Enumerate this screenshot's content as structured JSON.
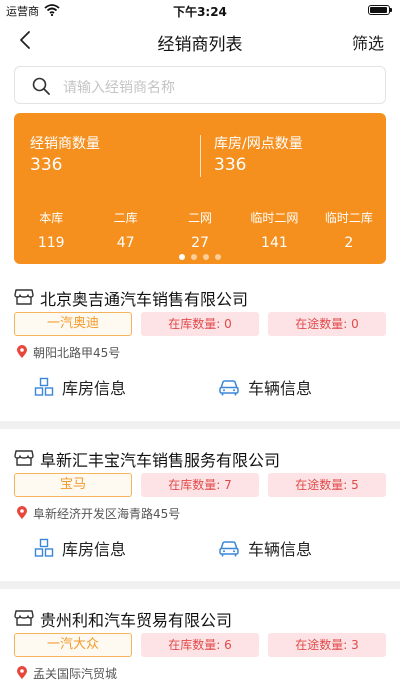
{
  "status_bar": {
    "carrier": "运营商",
    "time": "下午3:24"
  },
  "nav": {
    "title": "经销商列表",
    "filter_label": "筛选"
  },
  "search": {
    "placeholder": "请输入经销商名称"
  },
  "summary": {
    "dealer_count_label": "经销商数量",
    "dealer_count": "336",
    "warehouse_count_label": "库房/网点数量",
    "warehouse_count": "336",
    "stats": [
      {
        "label": "本库",
        "value": "119"
      },
      {
        "label": "二库",
        "value": "47"
      },
      {
        "label": "二网",
        "value": "27"
      },
      {
        "label": "临时二网",
        "value": "141"
      },
      {
        "label": "临时二库",
        "value": "2"
      }
    ],
    "carousel_pages": 4,
    "carousel_active": 1
  },
  "dealers": [
    {
      "name": "北京奥吉通汽车销售有限公司",
      "brand": "一汽奥迪",
      "in_stock": "在库数量: 0",
      "in_transit": "在途数量: 0",
      "address": "朝阳北路甲45号",
      "warehouse_label": "库房信息",
      "vehicle_label": "车辆信息"
    },
    {
      "name": "阜新汇丰宝汽车销售服务有限公司",
      "brand": "宝马",
      "in_stock": "在库数量: 7",
      "in_transit": "在途数量: 5",
      "address": "阜新经济开发区海青路45号",
      "warehouse_label": "库房信息",
      "vehicle_label": "车辆信息"
    },
    {
      "name": "贵州利和汽车贸易有限公司",
      "brand": "一汽大众",
      "in_stock": "在库数量: 6",
      "in_transit": "在途数量: 3",
      "address": "孟关国际汽贸城",
      "warehouse_label": "库房信息",
      "vehicle_label": "车辆信息"
    }
  ],
  "colors": {
    "accent": "#f5901e",
    "tag_bg": "#fde3e5",
    "tag_text": "#e04a4a",
    "brand_border": "#f5b45a",
    "icon_blue": "#3a86d8",
    "pin_red": "#e8473c"
  }
}
